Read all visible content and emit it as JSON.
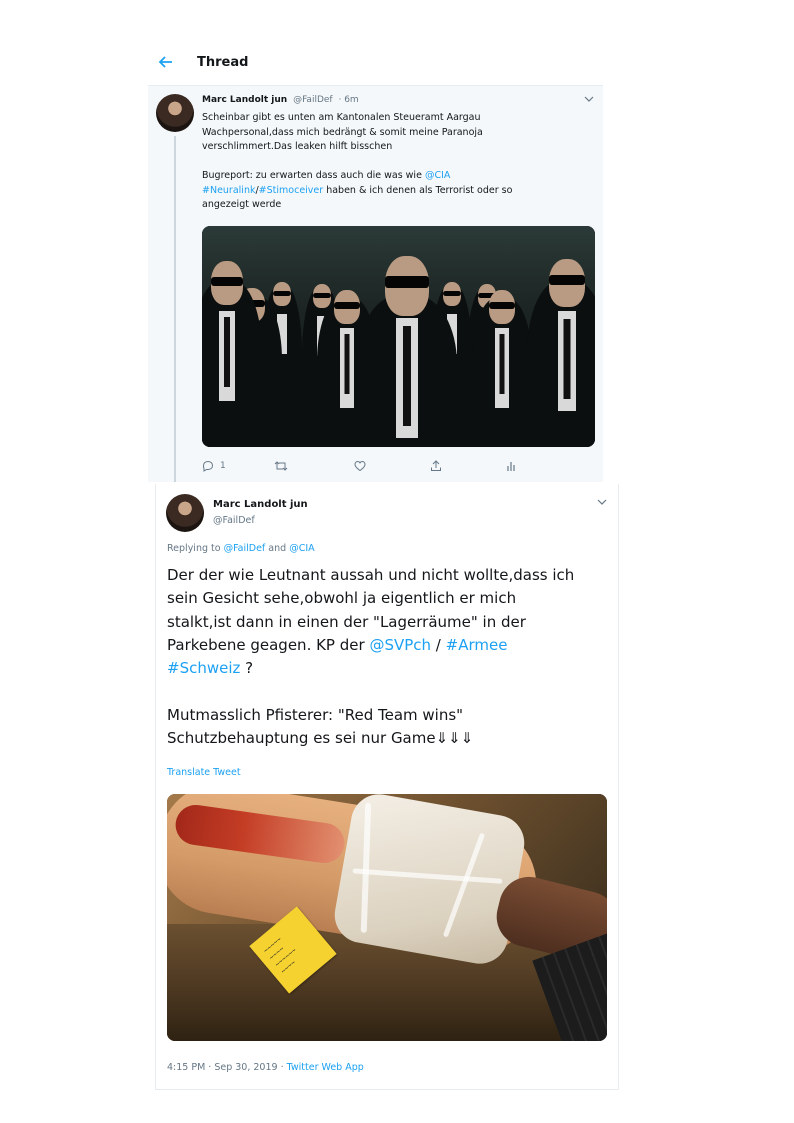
{
  "header": {
    "title": "Thread"
  },
  "tweet1": {
    "name": "Marc Landolt jun",
    "handle": "@FailDef",
    "time": "· 6m",
    "text_parts": [
      "Scheinbar gibt es unten am Kantonalen Steueramt Aargau\nWachpersonal,dass mich bedrängt & somit meine Paranoja\nverschlimmert.Das leaken hilft bisschen\n\nBugreport: zu erwarten dass auch die was wie ",
      "@CIA",
      "\n",
      "#Neuralink",
      "/",
      "#Stimoceiver",
      " haben & ich denen als Terrorist oder so\nangezeigt werde"
    ],
    "reply_count": "1"
  },
  "tweet2": {
    "name": "Marc Landolt jun",
    "handle": "@FailDef",
    "replying_prefix": "Replying to ",
    "replying_user1": "@FailDef",
    "replying_and": " and ",
    "replying_user2": "@CIA",
    "text_parts": [
      "Der der wie Leutnant aussah und nicht wollte,dass ich\nsein Gesicht sehe,obwohl ja eigentlich er mich\nstalkt,ist dann in einen der \"Lagerräume\" in der\nParkebene geagen. KP der ",
      "@SVPch",
      " / ",
      "#Armee",
      "\n",
      "#Schweiz",
      " ?\n\nMutmasslich Pfisterer: \"Red Team wins\"\nSchutzbehauptung es sei nur Game⇓⇓⇓"
    ],
    "translate_label": "Translate Tweet",
    "timestamp": "4:15 PM · Sep 30, 2019 · ",
    "source": "Twitter Web App"
  },
  "icons": {
    "back": "back-arrow-icon",
    "reply": "reply-icon",
    "retweet": "retweet-icon",
    "like": "heart-icon",
    "share": "share-icon",
    "analytics": "analytics-icon",
    "more": "chevron-down-icon"
  },
  "colors": {
    "link": "#1da1f2",
    "muted": "#657786",
    "text": "#14171a",
    "card_bg": "#f5f8fa"
  }
}
